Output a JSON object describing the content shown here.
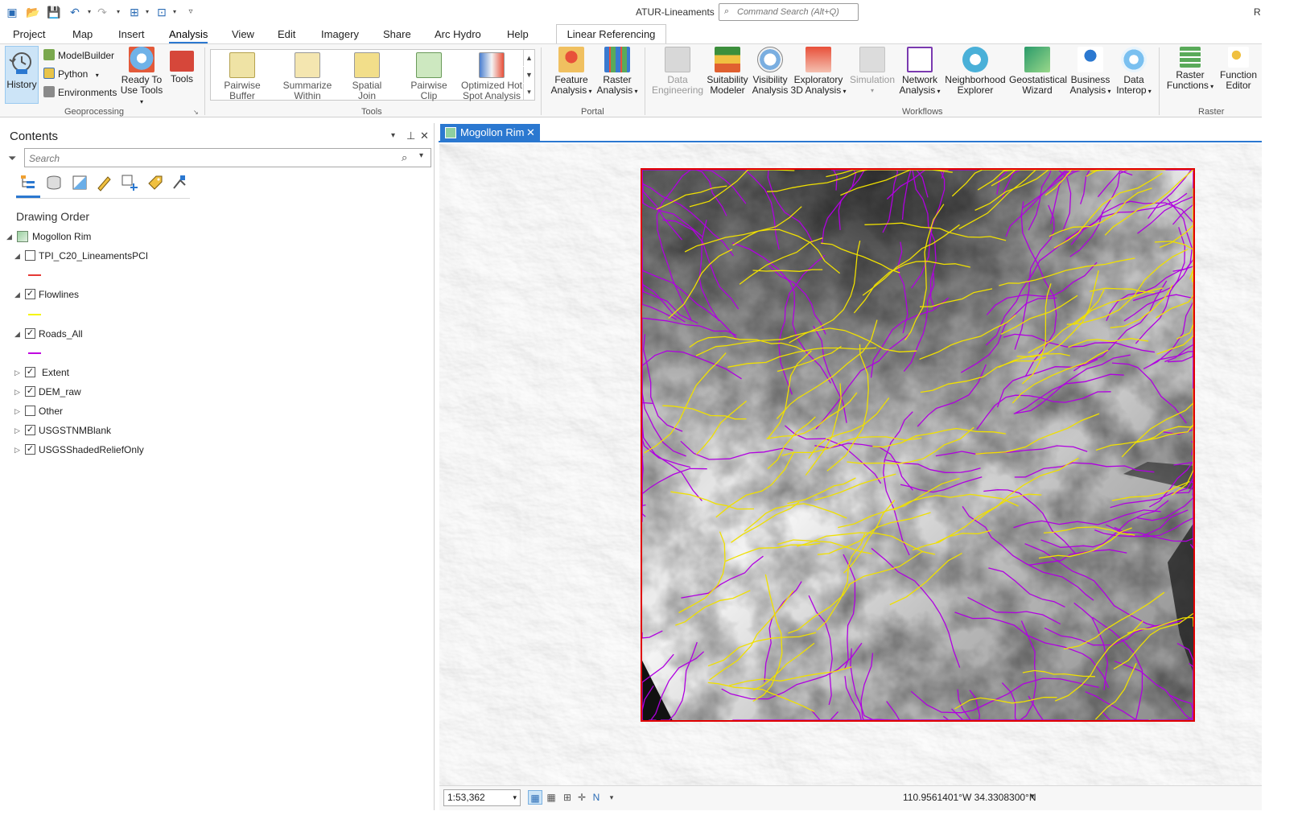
{
  "app": {
    "title": "ATUR-Lineaments",
    "user_initial": "R",
    "command_search_placeholder": "Command Search (Alt+Q)"
  },
  "ribbon_tabs": [
    "Project",
    "Map",
    "Insert",
    "Analysis",
    "View",
    "Edit",
    "Imagery",
    "Share",
    "Arc Hydro",
    "Help"
  ],
  "active_tab": "Analysis",
  "contextual_tab": "Linear Referencing",
  "geoprocessing": {
    "group_label": "Geoprocessing",
    "history": "History",
    "modelbuilder": "ModelBuilder",
    "python": "Python",
    "environments": "Environments",
    "ready_to_use_1": "Ready To",
    "ready_to_use_2": "Use Tools",
    "tools": "Tools"
  },
  "tools_group": {
    "group_label": "Tools",
    "items": [
      {
        "l1": "Pairwise",
        "l2": "Buffer"
      },
      {
        "l1": "Summarize",
        "l2": "Within"
      },
      {
        "l1": "Spatial",
        "l2": "Join"
      },
      {
        "l1": "Pairwise",
        "l2": "Clip"
      },
      {
        "l1": "Optimized Hot",
        "l2": "Spot Analysis"
      }
    ]
  },
  "portal_group": {
    "group_label": "Portal",
    "items": [
      {
        "l1": "Feature",
        "l2": "Analysis"
      },
      {
        "l1": "Raster",
        "l2": "Analysis"
      }
    ]
  },
  "workflows_group": {
    "group_label": "Workflows",
    "items": [
      {
        "l1": "Data",
        "l2": "Engineering"
      },
      {
        "l1": "Suitability",
        "l2": "Modeler"
      },
      {
        "l1": "Visibility",
        "l2": "Analysis"
      },
      {
        "l1": "Exploratory",
        "l2": "3D Analysis"
      },
      {
        "l1": "Simulation",
        "l2": ""
      },
      {
        "l1": "Network",
        "l2": "Analysis"
      },
      {
        "l1": "Neighborhood",
        "l2": "Explorer"
      },
      {
        "l1": "Geostatistical",
        "l2": "Wizard"
      },
      {
        "l1": "Business",
        "l2": "Analysis"
      },
      {
        "l1": "Data",
        "l2": "Interop"
      }
    ]
  },
  "raster_group": {
    "group_label": "Raster",
    "items": [
      {
        "l1": "Raster",
        "l2": "Functions"
      },
      {
        "l1": "Function",
        "l2": "Editor"
      }
    ]
  },
  "contents": {
    "title": "Contents",
    "search_placeholder": "Search",
    "drawing_order": "Drawing Order",
    "map_name": "Mogollon Rim",
    "layers": [
      {
        "name": "TPI_C20_LineamentsPCI",
        "checked": false,
        "symbol": "#e53935"
      },
      {
        "name": "Flowlines",
        "checked": true,
        "symbol": "#f5f500"
      },
      {
        "name": "Roads_All",
        "checked": true,
        "symbol": "#c000e0"
      },
      {
        "name": "Extent",
        "checked": true
      },
      {
        "name": "DEM_raw",
        "checked": true
      },
      {
        "name": "Other",
        "checked": false
      },
      {
        "name": "USGSTNMBlank",
        "checked": true
      },
      {
        "name": "USGSShadedReliefOnly",
        "checked": true
      }
    ]
  },
  "map": {
    "tab_label": "Mogollon Rim",
    "extent_color": "#e00000",
    "flowline_color": "#f0e000",
    "road_color": "#b000e0"
  },
  "status": {
    "scale": "1:53,362",
    "coordinates": "110.9561401°W 34.3308300°N"
  },
  "colors": {
    "accent": "#2b78d0",
    "history_bg": "#cce4f7"
  }
}
